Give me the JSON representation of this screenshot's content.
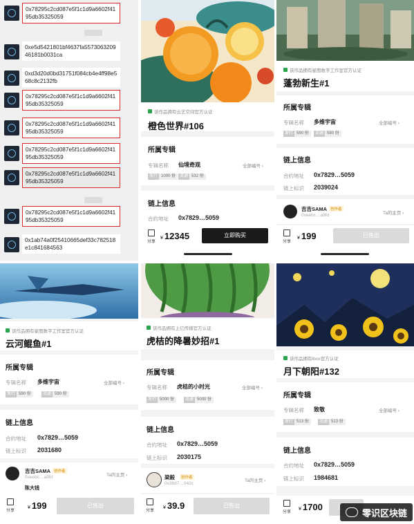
{
  "panel1": {
    "messages": [
      {
        "text": "0x78295c2cd087e5f1c1d9a6602f4195db35325059",
        "highlighted": true
      },
      {
        "text": "0xe5d5421801bf4637fa557306320946181b0031ca",
        "highlighted": false
      },
      {
        "text": "0xd3d20d0bd31751f084cb4e4ff98e568c8c2132fb",
        "highlighted": false
      },
      {
        "text": "0x78295c2cd087e5f1c1d9a6602f4195db35325059",
        "highlighted": true
      },
      {
        "text": "0x78295c2cd087e5f1c1d9a6602f4195db35325059",
        "highlighted": true
      },
      {
        "text": "0x78295c2cd087e5f1c1d9a6602f4195db35325059",
        "highlighted": true
      },
      {
        "text": "0x78295c2cd087e5f1c1d9a6602f4195db35325059",
        "highlighted": true
      },
      {
        "text": "0x78295c2cd087e5f1c1d9a6602f4195db35325059",
        "highlighted": true
      },
      {
        "text": "0x1ab74a0f25410665def33c782518e1c841684563",
        "highlighted": false
      }
    ]
  },
  "cards": [
    {
      "cert": "该作品拥有云艺空间官方认证",
      "title": "橙色世界#106",
      "album_section": "所属专辑",
      "album_label": "专辑名称",
      "album_name": "仙境奇观",
      "all_numbers": "全部编号 ›",
      "issue_key": "发行",
      "issue_val": "1000 份",
      "circ_key": "流通",
      "circ_val": "532 份",
      "chain_section": "链上信息",
      "contract_label": "合约地址",
      "contract_val": "0x7829…5059",
      "share": "分享",
      "price_currency": "¥",
      "price": "12345",
      "button": "立即购买"
    },
    {
      "cert": "该作品拥有星图数字工作室官方认证",
      "title": "蓬勃新生#1",
      "album_section": "所属专辑",
      "album_label": "专辑名称",
      "album_name": "多维宇宙",
      "all_numbers": "全部编号 ›",
      "issue_key": "发行",
      "issue_val": "590 份",
      "circ_key": "流通",
      "circ_val": "590 份",
      "chain_section": "链上信息",
      "contract_label": "合约地址",
      "contract_val": "0x7829…5059",
      "id_label": "链上标识",
      "id_val": "2039024",
      "user_name": "吉吉SAMA",
      "user_tag": "创作者",
      "user_addr": "0xeebc…a9fd",
      "user_link": "Ta的主页 ›",
      "share": "分享",
      "price_currency": "¥",
      "price": "199",
      "button": "已售出"
    },
    {
      "cert": "该作品拥有星图数字工作室官方认证",
      "title": "云河鲲鱼#1",
      "album_section": "所属专辑",
      "album_label": "专辑名称",
      "album_name": "多维宇宙",
      "all_numbers": "全部编号 ›",
      "issue_key": "发行",
      "issue_val": "590 份",
      "circ_key": "流通",
      "circ_val": "590 份",
      "chain_section": "链上信息",
      "contract_label": "合约地址",
      "contract_val": "0x7829…5059",
      "id_label": "链上标识",
      "id_val": "2031680",
      "user_name": "吉吉SAMA",
      "user_tag": "创作者",
      "user_addr": "0xeebc…a9fd",
      "user_link": "Ta的主页 ›",
      "second_user": "陈大钱",
      "share": "分享",
      "price_currency": "¥",
      "price": "199",
      "button": "已售出"
    },
    {
      "cert": "该作品拥有上亿传媒官方认证",
      "title": "虎桔的降暑妙招#1",
      "album_section": "所属专辑",
      "album_label": "专辑名称",
      "album_name": "虎桔的小时光",
      "all_numbers": "全部编号 ›",
      "issue_key": "发行",
      "issue_val": "5000 份",
      "circ_key": "流通",
      "circ_val": "5000 份",
      "chain_section": "链上信息",
      "contract_label": "合约地址",
      "contract_val": "0x7829…5059",
      "id_label": "链上标识",
      "id_val": "2030175",
      "user_name": "梁毅",
      "user_tag": "创作者",
      "user_addr": "0x36d7…042c",
      "user_link": "Ta的主页 ›",
      "share": "分享",
      "price_currency": "¥",
      "price": "39.9",
      "button": "已售出"
    },
    {
      "cert": "该作品拥有Ibox官方认证",
      "title": "月下朝阳#132",
      "album_section": "所属专辑",
      "album_label": "专辑名称",
      "album_name": "致敬",
      "all_numbers": "全部编号 ›",
      "issue_key": "发行",
      "issue_val": "513 份",
      "circ_key": "流通",
      "circ_val": "513 份",
      "chain_section": "链上信息",
      "contract_label": "合约地址",
      "contract_val": "0x7829…5059",
      "id_label": "链上标识",
      "id_val": "1984681",
      "share": "分享",
      "price_currency": "¥",
      "price": "1700",
      "button": "已售出"
    }
  ],
  "watermark": "零识区块链",
  "colors": {
    "highlight": "#d8262d",
    "cert_flag": "#2aa34a",
    "sold_button": "#dadada",
    "buy_button": "#1a1a1a"
  }
}
